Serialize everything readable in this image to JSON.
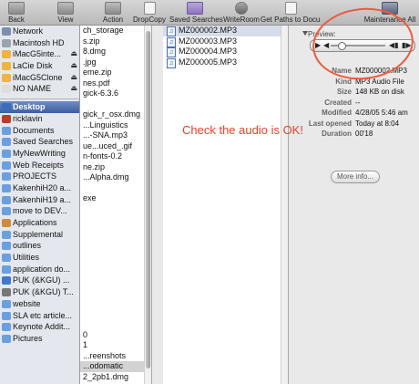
{
  "toolbar": {
    "items": [
      {
        "label": "Back"
      },
      {
        "label": "View"
      },
      {
        "label": "Action"
      },
      {
        "label": "DropCopy"
      },
      {
        "label": "Saved Searches"
      },
      {
        "label": "WriteRoom"
      },
      {
        "label": "Get Paths to Documents"
      },
      {
        "label": "Maintenance All"
      }
    ]
  },
  "sidebar": {
    "devices": [
      {
        "label": "Network",
        "icon": "network-icon",
        "color": "#7a8fb0",
        "eject": false
      },
      {
        "label": "Macintosh HD",
        "icon": "hard-disk-icon",
        "color": "#9aa3af",
        "eject": false
      },
      {
        "label": "iMacG5inte...",
        "icon": "hard-disk-icon",
        "color": "#f0b33c",
        "eject": true
      },
      {
        "label": "LaCie Disk",
        "icon": "hard-disk-icon",
        "color": "#f0b33c",
        "eject": true
      },
      {
        "label": "iMacG5Clone",
        "icon": "hard-disk-icon",
        "color": "#f0b33c",
        "eject": true
      },
      {
        "label": "NO NAME",
        "icon": "removable-disk-icon",
        "color": "#dedede",
        "eject": true
      }
    ],
    "places": [
      {
        "label": "Desktop",
        "icon": "desktop-icon",
        "color": "#3b6dbf",
        "selected": true
      },
      {
        "label": "ricklavin",
        "icon": "home-icon",
        "color": "#c0392b"
      },
      {
        "label": "Documents",
        "icon": "folder-icon",
        "color": "#6aa0e0"
      },
      {
        "label": "Saved Searches",
        "icon": "folder-icon",
        "color": "#6aa0e0"
      },
      {
        "label": "MyNewWriting",
        "icon": "folder-icon",
        "color": "#6aa0e0"
      },
      {
        "label": "Web Receipts",
        "icon": "folder-icon",
        "color": "#6aa0e0"
      },
      {
        "label": "PROJECTS",
        "icon": "folder-icon",
        "color": "#6aa0e0"
      },
      {
        "label": "KakenhiH20 a...",
        "icon": "folder-icon",
        "color": "#6aa0e0"
      },
      {
        "label": "KakenhiH19 a...",
        "icon": "folder-icon",
        "color": "#6aa0e0"
      },
      {
        "label": "move to DEV...",
        "icon": "folder-icon",
        "color": "#6aa0e0"
      },
      {
        "label": "Applications",
        "icon": "applications-icon",
        "color": "#d08a3a"
      },
      {
        "label": "Supplemental",
        "icon": "folder-icon",
        "color": "#6aa0e0"
      },
      {
        "label": "outlines",
        "icon": "folder-icon",
        "color": "#6aa0e0"
      },
      {
        "label": "Utilities",
        "icon": "folder-icon",
        "color": "#6aa0e0"
      },
      {
        "label": "application do...",
        "icon": "folder-icon",
        "color": "#6aa0e0"
      },
      {
        "label": "PUK (&KGU) ...",
        "icon": "globe-icon",
        "color": "#3f79c9"
      },
      {
        "label": "PUK (&KGU) T...",
        "icon": "gear-icon",
        "color": "#777777"
      },
      {
        "label": "website",
        "icon": "folder-icon",
        "color": "#6aa0e0"
      },
      {
        "label": "SLA etc article...",
        "icon": "folder-icon",
        "color": "#6aa0e0"
      },
      {
        "label": "Keynote Addit...",
        "icon": "folder-icon",
        "color": "#6aa0e0"
      },
      {
        "label": "Pictures",
        "icon": "folder-icon",
        "color": "#6aa0e0"
      }
    ]
  },
  "column1": {
    "rows": [
      "ch_storage",
      "s.zip",
      "8.dmg",
      ".jpg",
      "eme.zip",
      "nes.pdf",
      "gick-6.3.6",
      "",
      "gick_r_osx.dmg",
      "...Linguistics",
      "...-SNA.mp3",
      "ue...uced_.gif",
      "n-fonts-0.2",
      "ne.zip",
      "...Alpha.dmg",
      "",
      "exe",
      "",
      "",
      "",
      "",
      "",
      "",
      "",
      "",
      "",
      "",
      "",
      "",
      "0",
      "1",
      "...reenshots",
      "...odomatic",
      "2_2pb1.dmg"
    ],
    "selected_index": 32
  },
  "column2": {
    "files": [
      {
        "name": "MZ000002.MP3",
        "selected": true
      },
      {
        "name": "MZ000003.MP3",
        "selected": false
      },
      {
        "name": "MZ000004.MP3",
        "selected": false
      },
      {
        "name": "MZ000005.MP3",
        "selected": false
      }
    ]
  },
  "preview": {
    "label": "Preview:",
    "player_progress": 0.2,
    "meta": [
      {
        "key": "Name",
        "value": "MZ000002.MP3"
      },
      {
        "key": "Kind",
        "value": "MP3 Audio File"
      },
      {
        "key": "Size",
        "value": "148 KB on disk"
      },
      {
        "key": "Created",
        "value": "--"
      },
      {
        "key": "Modified",
        "value": "4/28/05 5:46 am"
      },
      {
        "key": "Last opened",
        "value": "Today at 8:04"
      },
      {
        "key": "Duration",
        "value": "00'18"
      }
    ],
    "more_info": "More info..."
  },
  "annotation": {
    "text": "Check the audio is OK!",
    "color": "#e8432a"
  }
}
